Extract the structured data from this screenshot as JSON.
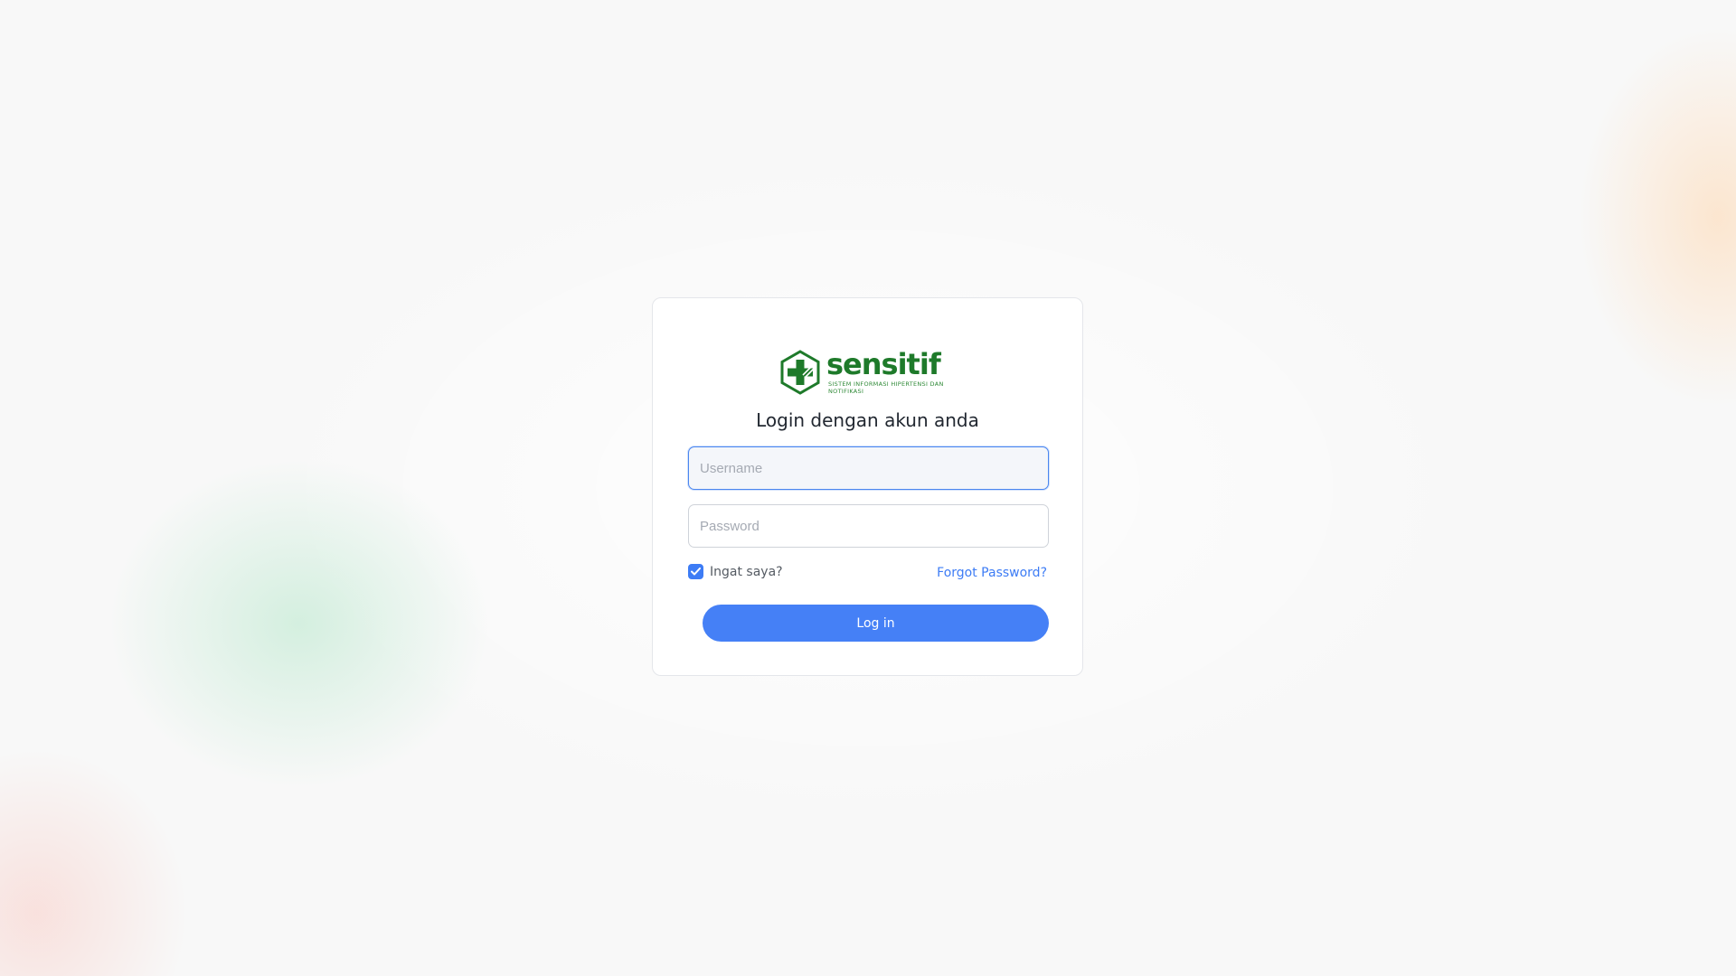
{
  "app": {
    "logo_name": "sensitif",
    "logo_tagline": "SISTEM INFORMASI HIPERTENSI DAN NOTIFIKASI",
    "logo_icon": "hexagon-medical-cross-icon",
    "brand_color": "#1e7a2a"
  },
  "login": {
    "title": "Login dengan akun anda",
    "username_placeholder": "Username",
    "username_value": "",
    "password_placeholder": "Password",
    "password_value": "",
    "remember_label": "Ingat saya?",
    "remember_checked": true,
    "forgot_label": "Forgot Password?",
    "submit_label": "Log in",
    "accent_color": "#4580f6"
  }
}
